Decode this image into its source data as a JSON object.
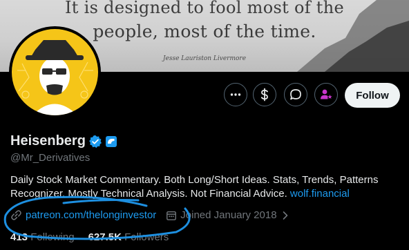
{
  "banner": {
    "quote_line1": "It is designed to fool most of the",
    "quote_line2": "people, most of the time.",
    "quote_author": "Jesse Lauriston Livermore"
  },
  "profile": {
    "display_name": "Heisenberg",
    "handle": "@Mr_Derivatives",
    "bio_text": "Daily Stock Market Commentary. Both Long/Short Ideas. Stats, Trends, Patterns Recognizer. Mostly Technical Analysis. Not Financial Advice.",
    "bio_link": "wolf.financial",
    "website": "patreon.com/thelonginvestor",
    "joined": "Joined January 2018"
  },
  "actions": {
    "follow_label": "Follow",
    "icons": [
      "more-icon",
      "dollar-tip-icon",
      "message-icon",
      "subscribe-icon"
    ]
  },
  "stats": {
    "following_count": "413",
    "following_label": "Following",
    "followers_count": "627.5K",
    "followers_label": "Followers"
  },
  "colors": {
    "background": "#000000",
    "link": "#1d9bf0",
    "verified": "#1d9bf0",
    "subscribe_accent": "#c936cc",
    "annotation_scribble": "#1d8fe0",
    "avatar_yellow": "#f5c518"
  }
}
